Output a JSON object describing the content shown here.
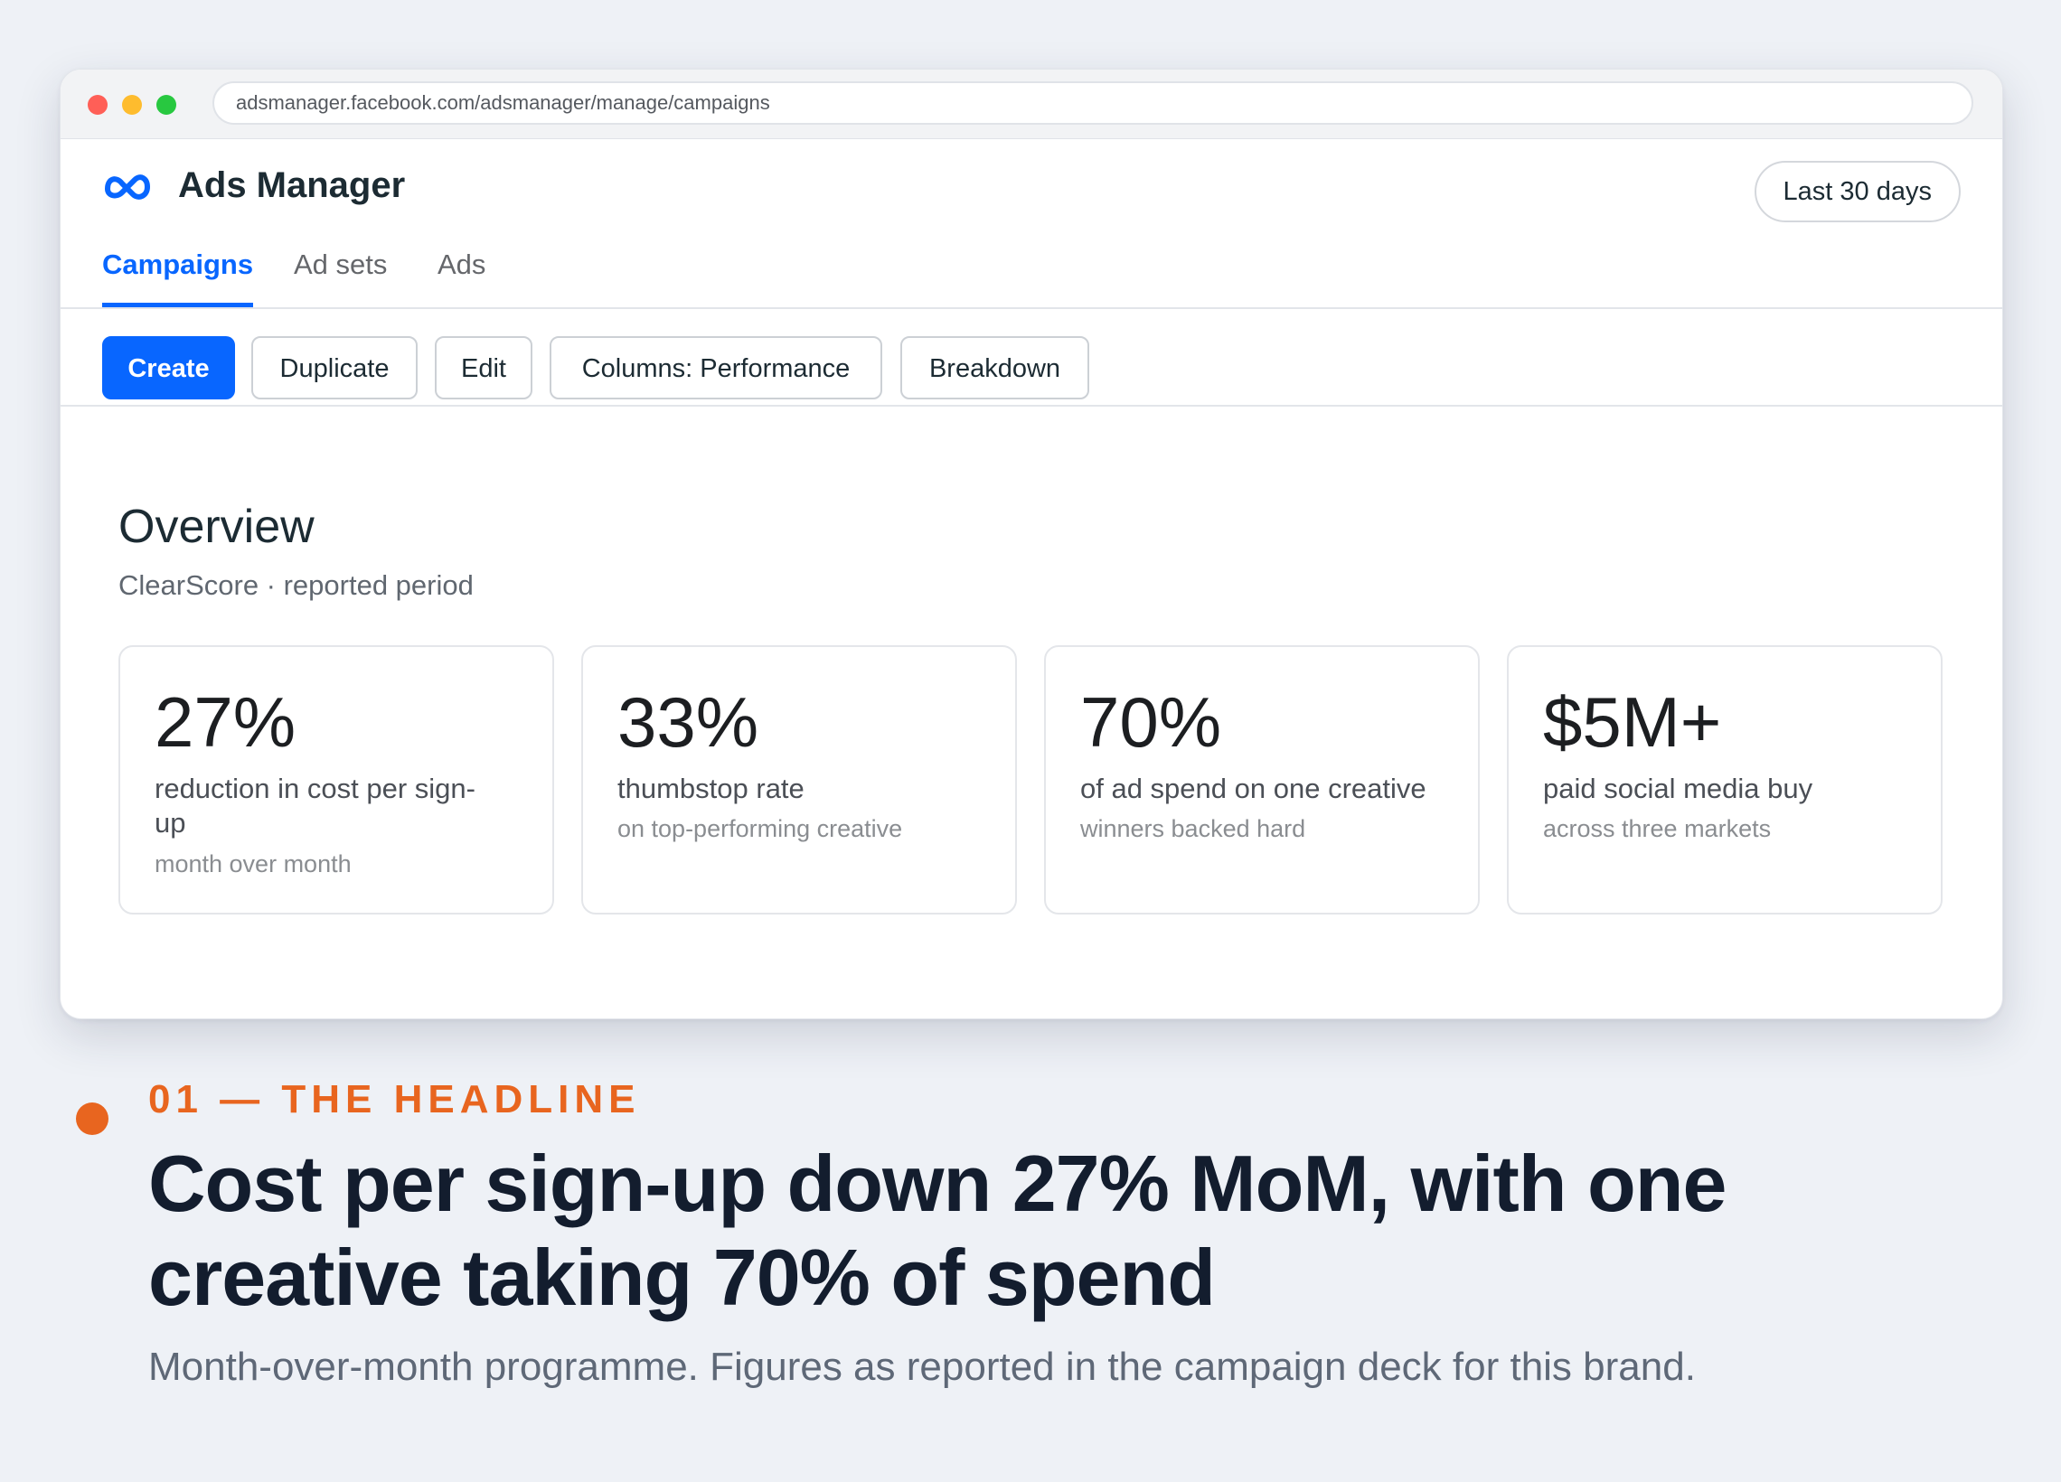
{
  "browser": {
    "url": "adsmanager.facebook.com/adsmanager/manage/campaigns"
  },
  "app": {
    "title": "Ads Manager",
    "date_range": "Last 30 days",
    "brand_color": "#0866ff"
  },
  "tabs": [
    {
      "label": "Campaigns",
      "active": true
    },
    {
      "label": "Ad sets",
      "active": false
    },
    {
      "label": "Ads",
      "active": false
    }
  ],
  "toolbar": {
    "create": "Create",
    "duplicate": "Duplicate",
    "edit": "Edit",
    "columns": "Columns: Performance",
    "breakdown": "Breakdown"
  },
  "overview": {
    "title": "Overview",
    "subtitle": "ClearScore · reported period",
    "cards": [
      {
        "value": "27%",
        "label": "reduction in cost per sign-up",
        "note": "month over month"
      },
      {
        "value": "33%",
        "label": "thumbstop rate",
        "note": "on top-performing creative"
      },
      {
        "value": "70%",
        "label": "of ad spend on one creative",
        "note": "winners backed hard"
      },
      {
        "value": "$5M+",
        "label": "paid social media buy",
        "note": "across three markets"
      }
    ]
  },
  "caption": {
    "eyebrow": "01 — THE HEADLINE",
    "headline": "Cost per sign-up down 27% MoM, with one creative taking 70% of spend",
    "subhead": "Month-over-month programme. Figures as reported in the campaign deck for this brand.",
    "accent_color": "#e8651f"
  }
}
